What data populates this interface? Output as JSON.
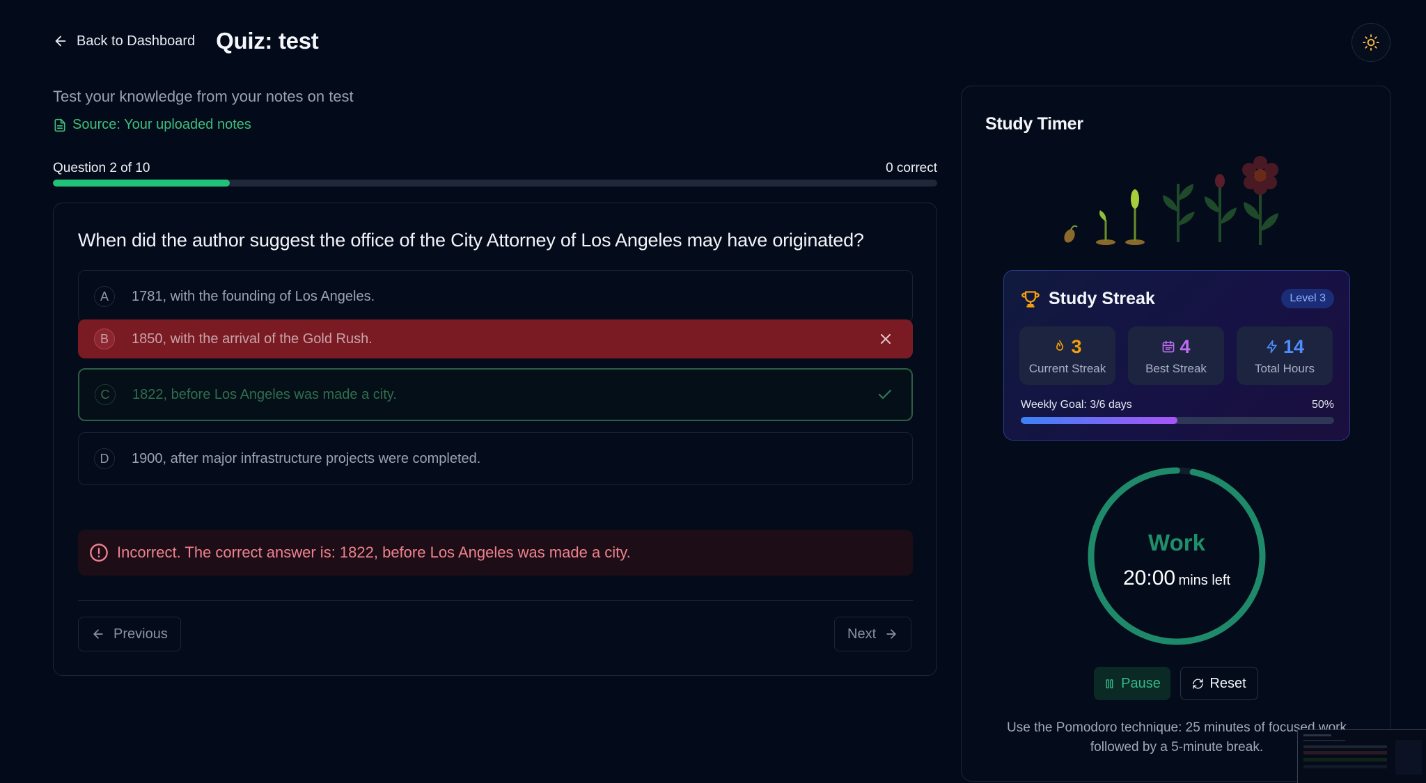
{
  "header": {
    "back_label": "Back to Dashboard",
    "title": "Quiz: test"
  },
  "intro": {
    "subtitle": "Test your knowledge from your notes on test",
    "source": "Source: Your uploaded notes"
  },
  "progress": {
    "label": "Question 2 of 10",
    "correct": "0 correct",
    "fraction": 0.2
  },
  "quiz": {
    "question": "When did the author suggest the office of the City Attorney of Los Angeles may have originated?",
    "options": [
      {
        "letter": "A",
        "text": "1781, with the founding of Los Angeles.",
        "state": "default"
      },
      {
        "letter": "B",
        "text": "1850, with the arrival of the Gold Rush.",
        "state": "wrong"
      },
      {
        "letter": "C",
        "text": "1822, before Los Angeles was made a city.",
        "state": "correct"
      },
      {
        "letter": "D",
        "text": "1900, after major infrastructure projects were completed.",
        "state": "default"
      }
    ],
    "feedback": "Incorrect. The correct answer is: 1822, before Los Angeles was made a city.",
    "prev_label": "Previous",
    "next_label": "Next"
  },
  "timer": {
    "title": "Study Timer",
    "streak": {
      "title": "Study Streak",
      "level": "Level 3",
      "stats": [
        {
          "value": "3",
          "label": "Current Streak",
          "icon": "flame-icon"
        },
        {
          "value": "4",
          "label": "Best Streak",
          "icon": "calendar-icon"
        },
        {
          "value": "14",
          "label": "Total Hours",
          "icon": "lightning-icon"
        }
      ],
      "weekly_label": "Weekly Goal: 3/6 days",
      "weekly_percent": "50%",
      "weekly_fraction": 0.5
    },
    "mode": "Work",
    "time": "20:00",
    "time_suffix": "mins left",
    "remaining_fraction": 0.97,
    "pause_label": "Pause",
    "reset_label": "Reset",
    "tip": "Use the Pomodoro technique: 25 minutes of focused work followed by a 5-minute break."
  },
  "colors": {
    "background": "#030a1a",
    "accent_green": "#22c17a",
    "wrong_red": "#7a1b24",
    "feedback_red": "#f0828d",
    "streak_orange": "#f59e0b",
    "streak_purple": "#c06cf0",
    "streak_blue": "#4f8dff"
  }
}
